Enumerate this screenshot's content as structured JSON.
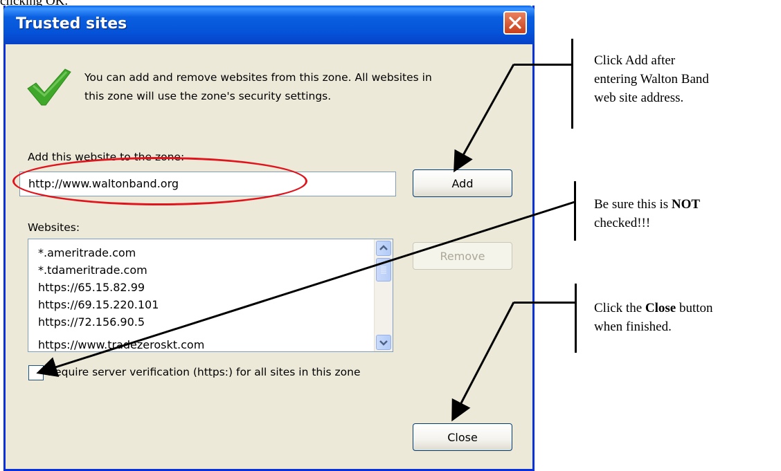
{
  "top_fragment": "clicking OK.",
  "window": {
    "title": "Trusted sites"
  },
  "icons": {
    "close": "close-x-icon",
    "check": "green-checkmark-icon"
  },
  "description": {
    "line1": "You can add and remove websites from this zone. All websites in",
    "line2": "this zone will use the zone's security settings."
  },
  "add_section": {
    "label": "Add this website to the zone:",
    "value": "http://www.waltonband.org",
    "add_button": "Add"
  },
  "websites": {
    "label": "Websites:",
    "items": [
      "*.ameritrade.com",
      "*.tdameritrade.com",
      "https://65.15.82.99",
      "https://69.15.220.101",
      "https://72.156.90.5",
      "https://www.tradezeroskt.com"
    ],
    "remove_button": "Remove"
  },
  "verification": {
    "label": "Require server verification (https:) for all sites in this zone",
    "checked": false
  },
  "close_button": "Close",
  "annotations": {
    "add_note": [
      "Click Add after",
      "entering Walton Band",
      "web site address."
    ],
    "check_note": {
      "before": "Be sure this is ",
      "bold": "NOT",
      "after": "checked!!!"
    },
    "close_note": {
      "before": "Click the ",
      "bold": "Close",
      "after": " button",
      "line2": "when finished."
    }
  },
  "colors": {
    "title_bar": "#0553d8",
    "dialog_bg": "#ece9d8",
    "highlight_ellipse": "#e0141c",
    "close_button": "#c8401c"
  }
}
